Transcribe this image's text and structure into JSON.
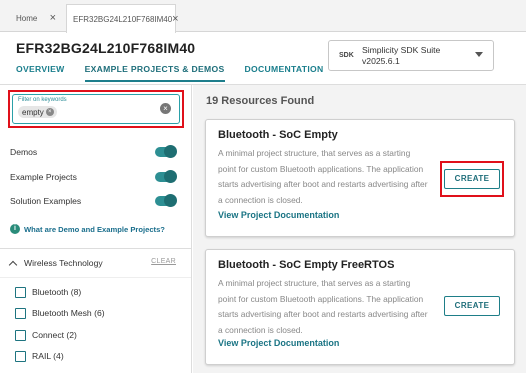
{
  "tabs": [
    {
      "label": "Home",
      "active": false
    },
    {
      "label": "EFR32BG24L210F768IM40",
      "active": true
    }
  ],
  "header": {
    "title": "EFR32BG24L210F768IM40",
    "nav": [
      {
        "label": "OVERVIEW",
        "active": false
      },
      {
        "label": "EXAMPLE PROJECTS & DEMOS",
        "active": true
      },
      {
        "label": "DOCUMENTATION",
        "active": false
      }
    ],
    "sdk": {
      "badge": "SDK",
      "name": "Simplicity SDK Suite",
      "version": "v2025.6.1"
    }
  },
  "filter": {
    "label": "Filter on keywords",
    "chip": "empty"
  },
  "toggles": [
    {
      "label": "Demos",
      "on": true
    },
    {
      "label": "Example Projects",
      "on": true
    },
    {
      "label": "Solution Examples",
      "on": true
    }
  ],
  "help_link": "What are Demo and Example Projects?",
  "wireless": {
    "header": "Wireless Technology",
    "clear": "CLEAR",
    "items": [
      {
        "label": "Bluetooth (8)"
      },
      {
        "label": "Bluetooth Mesh (6)"
      },
      {
        "label": "Connect (2)"
      },
      {
        "label": "RAIL (4)"
      }
    ]
  },
  "results": {
    "count_label": "19 Resources Found",
    "cards": [
      {
        "title": "Bluetooth - SoC Empty",
        "desc": "A minimal project structure, that serves as a starting point for custom Bluetooth applications. The application starts advertising after boot and restarts advertising after a connection is closed.",
        "link": "View Project Documentation",
        "button": "CREATE"
      },
      {
        "title": "Bluetooth - SoC Empty FreeRTOS",
        "desc": "A minimal project structure, that serves as a starting point for custom Bluetooth applications. The application starts advertising after boot and restarts advertising after a connection is closed.",
        "link": "View Project Documentation",
        "button": "CREATE"
      }
    ]
  },
  "colors": {
    "accent": "#1e7e88",
    "highlight": "#e0101a",
    "toggle": "#2d8f93"
  }
}
